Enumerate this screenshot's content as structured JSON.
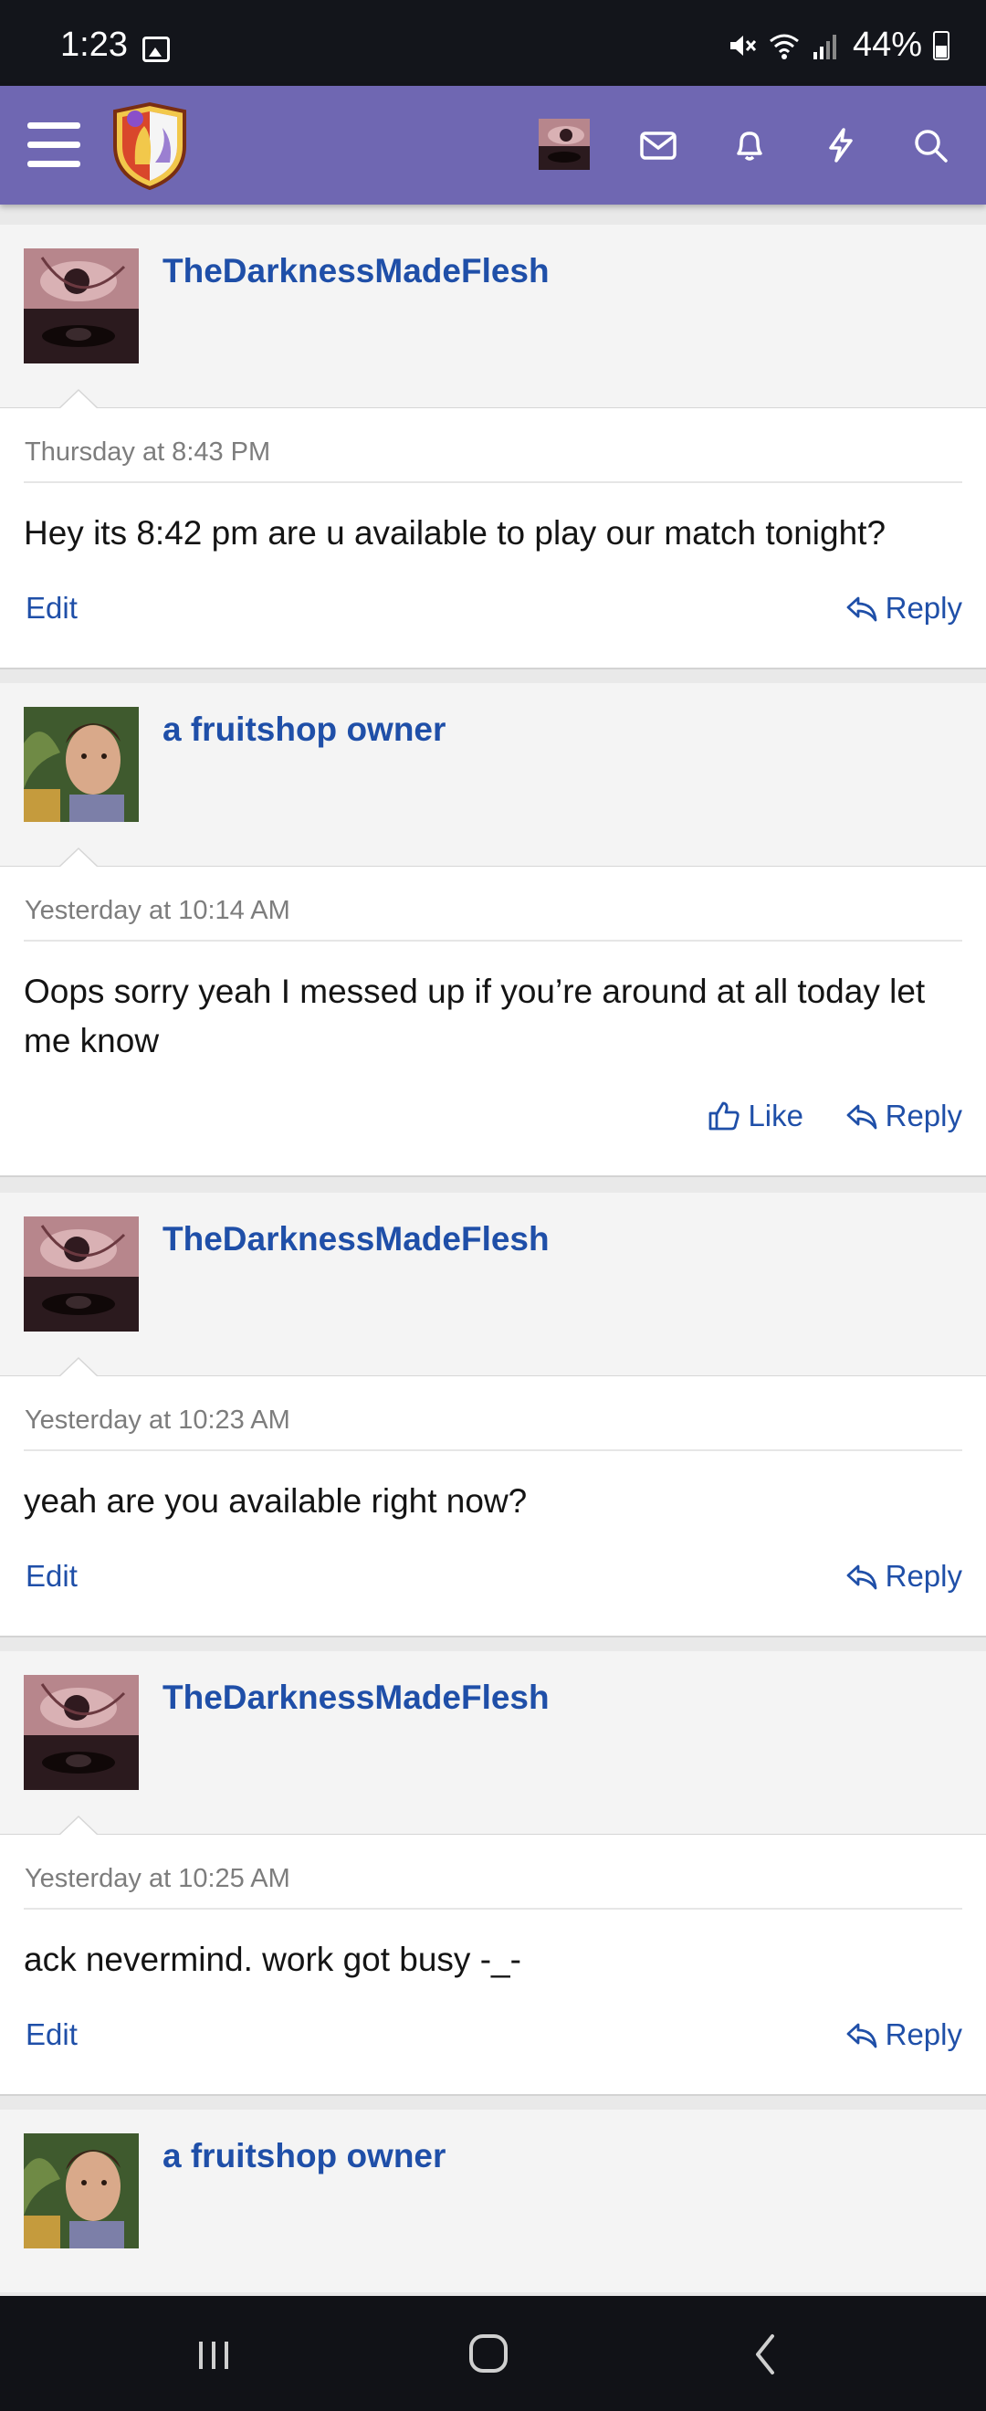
{
  "status_bar": {
    "time": "1:23",
    "battery": "44%",
    "icons": [
      "gallery-icon",
      "mute-icon",
      "wifi-icon",
      "signal-icon",
      "battery-icon"
    ]
  },
  "header": {
    "icons": [
      "menu-icon",
      "site-logo",
      "user-avatar",
      "inbox-icon",
      "bell-icon",
      "lightning-icon",
      "search-icon"
    ],
    "brand_color": "#6f67b2"
  },
  "colors": {
    "link": "#1f4fa8",
    "meta": "#7d7d7d"
  },
  "posts": [
    {
      "username": "TheDarknessMadeFlesh",
      "timestamp": "Thursday at 8:43 PM",
      "message": "Hey its 8:42 pm are u available to play our match tonight?",
      "left_action": "Edit",
      "reply": "Reply"
    },
    {
      "username": "a fruitshop owner",
      "timestamp": "Yesterday at 10:14 AM",
      "message": "Oops sorry yeah I messed up if you’re around at all today let me know",
      "like": "Like",
      "reply": "Reply"
    },
    {
      "username": "TheDarknessMadeFlesh",
      "timestamp": "Yesterday at 10:23 AM",
      "message": "yeah are you available right now?",
      "left_action": "Edit",
      "reply": "Reply"
    },
    {
      "username": "TheDarknessMadeFlesh",
      "timestamp": "Yesterday at 10:25 AM",
      "message": "ack nevermind. work got busy -_-",
      "left_action": "Edit",
      "reply": "Reply"
    },
    {
      "username": "a fruitshop owner"
    }
  ],
  "nav_bar": {
    "icons": [
      "recent-apps-icon",
      "home-icon",
      "back-icon"
    ]
  }
}
